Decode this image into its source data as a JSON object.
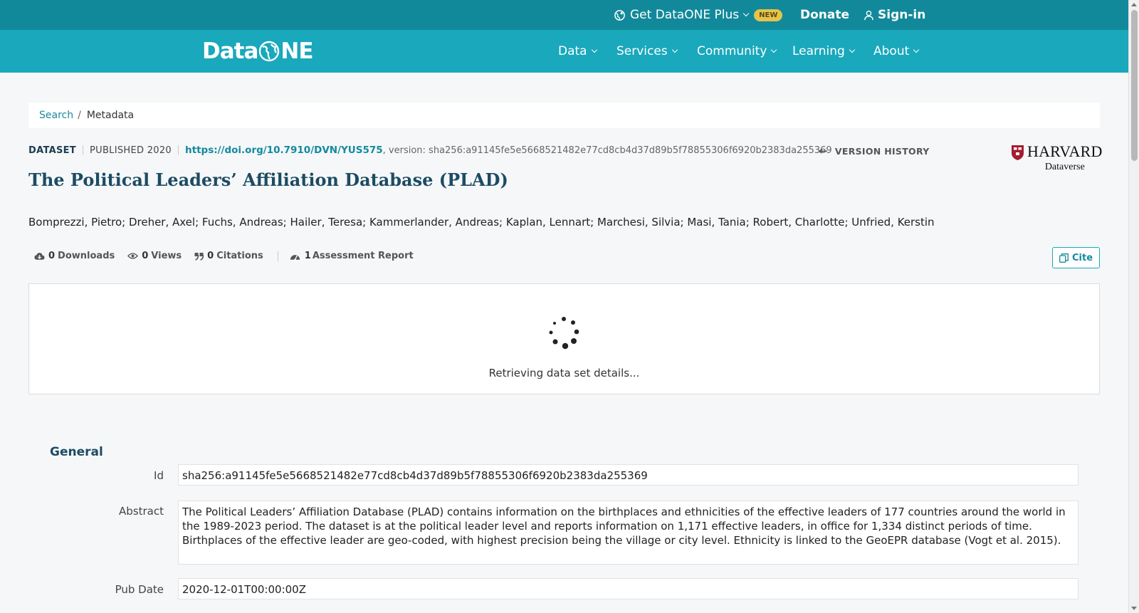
{
  "topbar": {
    "get_plus": "Get DataONE Plus",
    "new_badge": "NEW",
    "donate": "Donate",
    "sign_in": "Sign-in"
  },
  "logo": {
    "left": "Data",
    "right": "NE"
  },
  "nav": {
    "items": [
      {
        "label": "Data"
      },
      {
        "label": "Services"
      },
      {
        "label": "Community"
      },
      {
        "label": "Learning"
      },
      {
        "label": "About"
      }
    ]
  },
  "breadcrumb": {
    "search": "Search",
    "separator": "/",
    "current": "Metadata"
  },
  "dataset": {
    "type": "DATASET",
    "published": "PUBLISHED 2020",
    "doi": "https://doi.org/10.7910/DVN/YUS575",
    "version": ", version: sha256:a91145fe5e5668521482e77cd8cb4d37d89b5f78855306f6920b2383da255369",
    "version_history": "VERSION HISTORY",
    "title": "The Political Leaders’ Affiliation Database (PLAD)",
    "authors": "Bomprezzi, Pietro; Dreher, Axel; Fuchs, Andreas; Hailer, Teresa; Kammerlander, Andreas; Kaplan, Lennart; Marchesi, Silvia; Masi, Tania; Robert, Charlotte; Unfried, Kerstin"
  },
  "repository": {
    "name": "HARVARD",
    "sub": "Dataverse"
  },
  "metrics": {
    "downloads_count": "0",
    "downloads_label": "Downloads",
    "views_count": "0",
    "views_label": "Views",
    "citations_count": "0",
    "citations_label": "Citations",
    "assessment_count": "1",
    "assessment_label": "Assessment Report"
  },
  "cite_button": "Cite",
  "loading": {
    "text": "Retrieving data set details..."
  },
  "general": {
    "title": "General",
    "id_label": "Id",
    "id_value": "sha256:a91145fe5e5668521482e77cd8cb4d37d89b5f78855306f6920b2383da255369",
    "abstract_label": "Abstract",
    "abstract_value": "The Political Leaders’ Affiliation Database (PLAD) contains information on the birthplaces and ethnicities of the effective leaders of 177 countries around the world in the 1989-2023 period. The dataset is at the political leader level and reports information on 1,171 effective leaders, in office for 1,334 distinct periods of time. Birthplaces of the effective leader are geo-coded, with highest precision being the village or city level. Ethnicity is linked to the GeoEPR database (Vogt et al. 2015).",
    "pubdate_label": "Pub Date",
    "pubdate_value": "2020-12-01T00:00:00Z"
  },
  "colors": {
    "topbar": "#12899a",
    "navbar": "#19a8bc",
    "title": "#1d4b63",
    "link": "#138a9e"
  }
}
